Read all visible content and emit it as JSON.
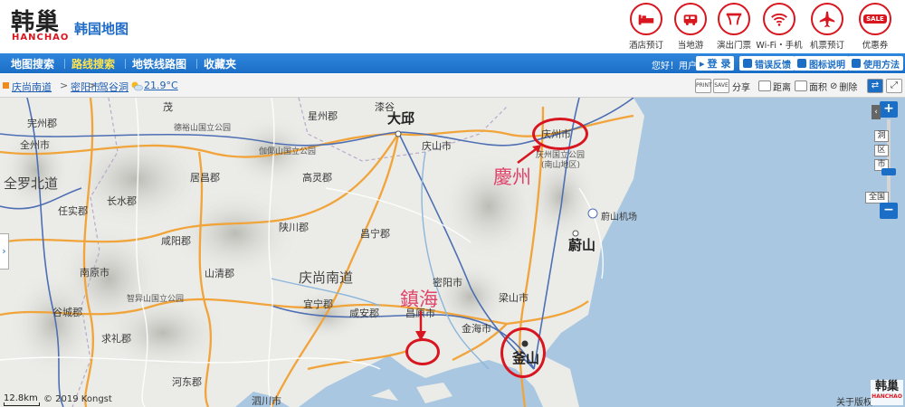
{
  "brand": {
    "logo_cn": "韩巢",
    "logo_en": "HANCHAO",
    "site_title": "韩国地图"
  },
  "services": [
    {
      "label": "酒店预订",
      "icon": "hotel-bed-icon"
    },
    {
      "label": "当地游",
      "icon": "tour-bus-icon"
    },
    {
      "label": "演出门票",
      "icon": "theater-stage-icon"
    },
    {
      "label": "Wi-Fi・手机",
      "icon": "wifi-icon"
    },
    {
      "label": "机票预订",
      "icon": "airplane-icon"
    },
    {
      "label": "优惠券",
      "icon": "sale-coupon-icon",
      "badge": "SALE"
    }
  ],
  "nav": {
    "items": [
      "地图搜索",
      "路线搜索",
      "地铁线路图",
      "收藏夹"
    ],
    "active_index": 1,
    "greeting": "您好！用户",
    "login": "登 录",
    "feedback": "错误反馈",
    "legend": "图标说明",
    "help": "使用方法"
  },
  "breadcrumb": {
    "items": [
      "庆尚南道",
      "密阳市",
      "驾谷洞"
    ],
    "temperature": "21.9°C"
  },
  "tools": [
    "分享",
    "距离",
    "面积",
    "删除"
  ],
  "tool_icons": [
    "PRINT",
    "SAVE"
  ],
  "map": {
    "labels": {
      "daegu": "大邱",
      "gyeongsan": "庆山市",
      "gyeongju": "庆州市",
      "gyeongju_park": "庆州国立公园",
      "gyeongju_park_sub": "(南山地区)",
      "ulsan_airport": "蔚山机场",
      "ulsan": "蔚山",
      "busan": "釜山",
      "yangsan": "梁山市",
      "gimhae": "金海市",
      "changwon": "昌原市",
      "miryang": "密阳市",
      "changnyeong": "昌宁郡",
      "haman": "咸安郡",
      "uiryeong": "宜宁郡",
      "gyeongsangnamdo": "庆尚南道",
      "hapcheon": "陕川郡",
      "goryeong": "高灵郡",
      "seongju": "星州郡",
      "chilgok": "漆谷",
      "deogyusan": "德裕山国立公园",
      "gayasan": "伽倻山国立公园",
      "geochang": "居昌郡",
      "hamyang": "咸阳郡",
      "sancheong": "山清郡",
      "jirisan": "智异山国立公园",
      "namwon": "南原市",
      "jangsu": "长水郡",
      "imsil": "任实郡",
      "jeonbuk": "全罗北道",
      "wanju": "完州郡",
      "jeonju": "全州市",
      "gokseong": "谷城郡",
      "gurye": "求礼郡",
      "hadong": "河东郡",
      "sacheon": "泗川市",
      "muju": "茂"
    },
    "annotations": {
      "gyeongju": "慶州",
      "jinhae": "鎮海"
    },
    "zoom_levels": [
      "洞",
      "区",
      "市",
      "全国"
    ],
    "scale": "12.8km",
    "copyright": "© 2019 Kongst",
    "about": "关于版权",
    "watermark_cn": "韩巢",
    "watermark_en": "HANCHAO"
  },
  "colors": {
    "nav_blue": "#1b6ec6",
    "brand_red": "#d8161f",
    "active_nav": "#ffe44d",
    "annotation_pink": "#e0446a",
    "sea": "#a9c7e1"
  }
}
